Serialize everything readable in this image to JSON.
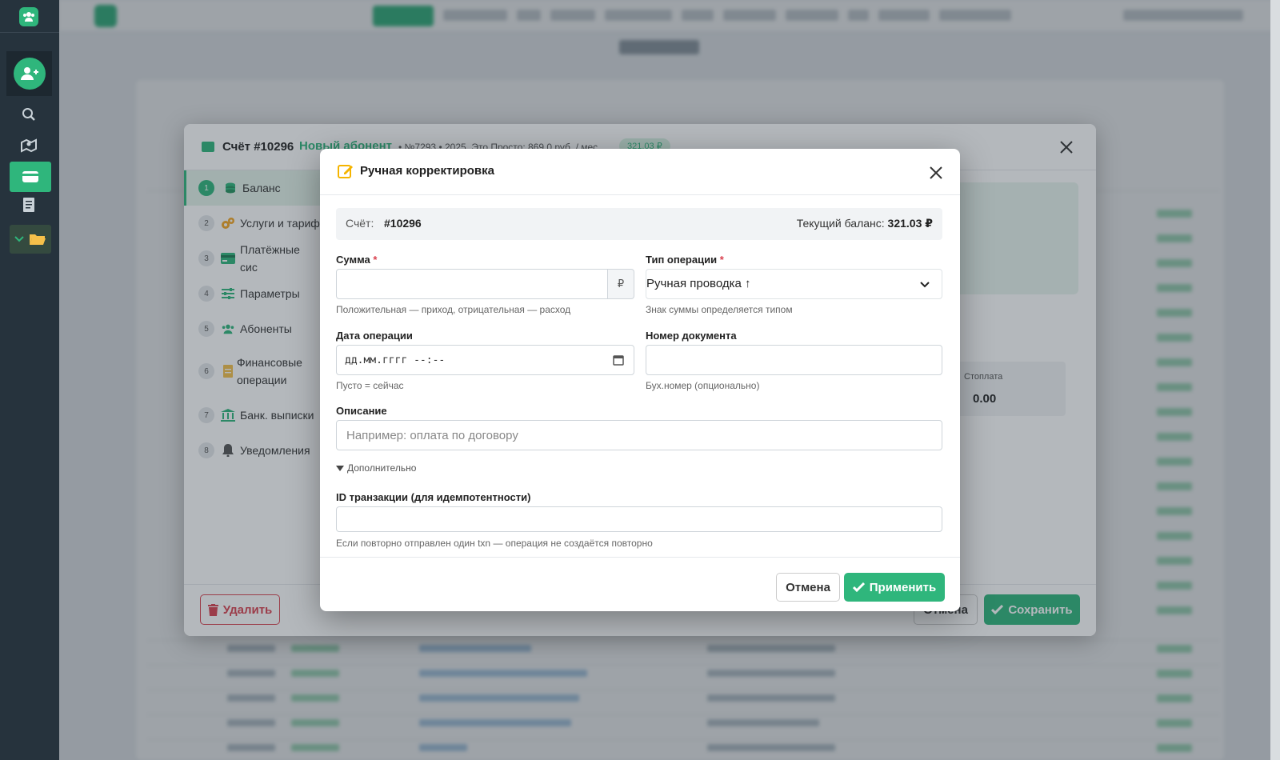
{
  "account_modal": {
    "title": "Счёт #10296",
    "subtitle": "Новый абонент",
    "subtitle_extra": "• №7293 • 2025, Это Просто: 869.0 руб. / мес",
    "badge": "321.03 ₽",
    "nav": [
      {
        "num": "1",
        "label": "Баланс"
      },
      {
        "num": "2",
        "label": "Услуги и тариф"
      },
      {
        "num": "3",
        "label": "Платёжные сис"
      },
      {
        "num": "4",
        "label": "Параметры"
      },
      {
        "num": "5",
        "label": "Абоненты"
      },
      {
        "num": "6",
        "label": "Финансовые операции"
      },
      {
        "num": "7",
        "label": "Банк. выписки"
      },
      {
        "num": "8",
        "label": "Уведомления"
      }
    ],
    "stop_label": "Стоплата",
    "stop_value": "0.00",
    "delete_label": "Удалить",
    "cancel_label": "Отмена",
    "save_label": "Сохранить"
  },
  "modal": {
    "title": "Ручная корректировка",
    "account_label": "Счёт:",
    "account_value": "#10296",
    "balance_label": "Текущий баланс:",
    "balance_value": "321.03 ₽",
    "amount": {
      "label": "Сумма",
      "required": "*",
      "value": "",
      "addon": "₽",
      "help": "Положительная — приход, отрицательная — расход"
    },
    "op_type": {
      "label": "Тип операции",
      "required": "*",
      "selected": "Ручная проводка ↑",
      "help": "Знак суммы определяется типом"
    },
    "op_date": {
      "label": "Дата операции",
      "placeholder": "дд.мм.гггг --:--",
      "help": "Пусто = сейчас"
    },
    "doc_number": {
      "label": "Номер документа",
      "value": "",
      "help": "Бух.номер (опционально)"
    },
    "description": {
      "label": "Описание",
      "placeholder": "Например: оплата по договору"
    },
    "more_label": "Дополнительно",
    "txn_id": {
      "label": "ID транзакции (для идемпотентности)",
      "value": "",
      "help": "Если повторно отправлен один txn — операция не создаётся повторно"
    },
    "cancel_label": "Отмена",
    "apply_label": "Применить"
  },
  "colors": {
    "accent": "#2fb67c",
    "danger": "#d9414f",
    "sidebar": "#26333d"
  },
  "icons": {
    "sidebar": [
      "users-logo-icon",
      "add-user-icon",
      "search-icon",
      "map-icon",
      "wallet-icon",
      "receipt-icon",
      "folder-icon"
    ]
  }
}
